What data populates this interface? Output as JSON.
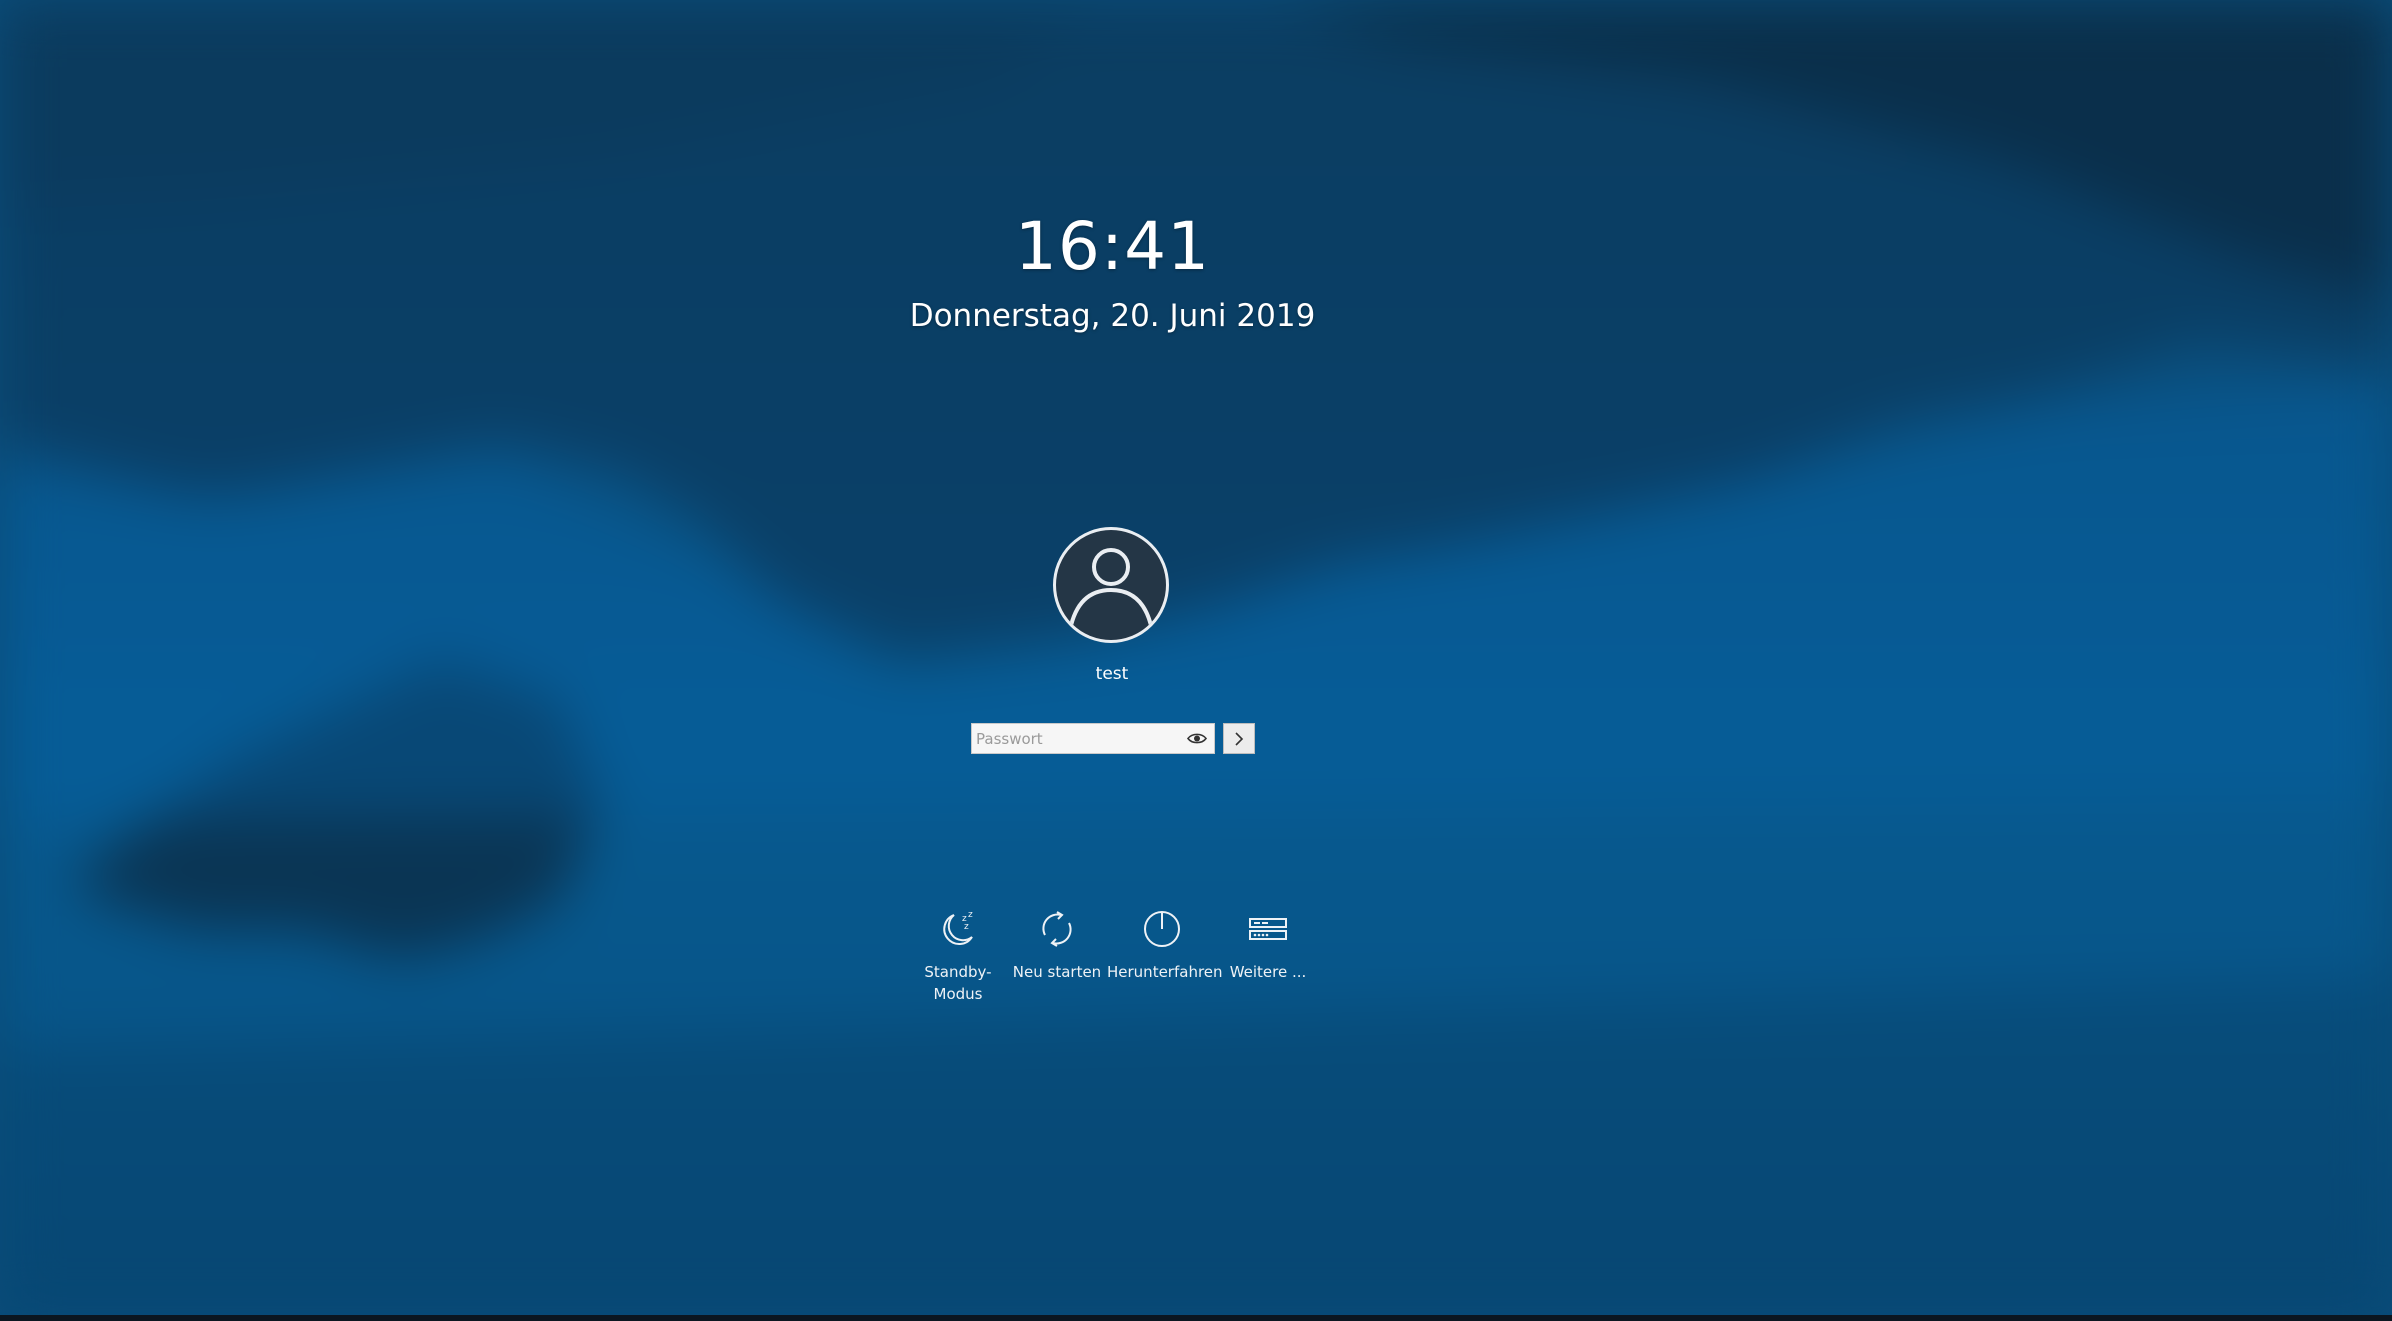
{
  "lockscreen": {
    "time": "16:41",
    "date": "Donnerstag, 20. Juni 2019"
  },
  "user": {
    "name": "test",
    "avatar_icon": "user-icon"
  },
  "password": {
    "value": "",
    "placeholder": "Passwort",
    "reveal_icon": "eye-icon",
    "submit_icon": "chevron-right-icon"
  },
  "actions": [
    {
      "label": "Standby-Modus",
      "icon": "sleep-icon"
    },
    {
      "label": "Neu starten",
      "icon": "restart-icon"
    },
    {
      "label": "Herunterfahren",
      "icon": "power-icon"
    },
    {
      "label": "Weitere ...",
      "icon": "more-sessions-icon"
    }
  ],
  "colors": {
    "background": "#0a4d7a",
    "text": "#ffffff",
    "avatar_fill": "#243646"
  }
}
